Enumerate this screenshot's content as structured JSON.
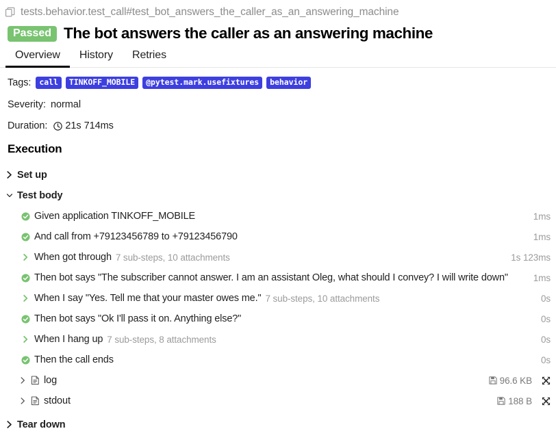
{
  "header": {
    "copy_icon": "copy-icon",
    "full_name": "tests.behavior.test_call#test_bot_answers_the_caller_as_an_answering_machine",
    "status": "Passed",
    "status_color": "#79c371",
    "title": "The bot answers the caller as an answering machine"
  },
  "tabs": [
    {
      "label": "Overview",
      "active": true
    },
    {
      "label": "History",
      "active": false
    },
    {
      "label": "Retries",
      "active": false
    }
  ],
  "meta": {
    "tags_label": "Tags:",
    "tag_chip_color": "#3d3fe0",
    "tags": [
      "call",
      "TINKOFF_MOBILE",
      "@pytest.mark.usefixtures",
      "behavior"
    ],
    "severity_label": "Severity:",
    "severity_value": "normal",
    "duration_label": "Duration:",
    "duration_icon": "clock-icon",
    "duration_value": "21s 714ms"
  },
  "execution": {
    "heading": "Execution",
    "setup": {
      "label": "Set up",
      "icon": "chevron-right-icon",
      "expanded": false
    },
    "test_body": {
      "label": "Test body",
      "icon": "chevron-down-icon",
      "expanded": true,
      "steps": [
        {
          "icon": "check-circle-icon",
          "name": "Given application TINKOFF_MOBILE",
          "sub": "",
          "duration": "1ms"
        },
        {
          "icon": "check-circle-icon",
          "name": "And call from +79123456789 to +79123456790",
          "sub": "",
          "duration": "1ms"
        },
        {
          "icon": "chevron-right-icon",
          "name": "When got through",
          "sub": "7 sub-steps, 10 attachments",
          "duration": "1s 123ms"
        },
        {
          "icon": "check-circle-icon",
          "name": "Then bot says \"The subscriber cannot answer. I am an assistant Oleg, what should I convey? I will write down\"",
          "sub": "",
          "duration": "1ms"
        },
        {
          "icon": "chevron-right-icon",
          "name": "When I say \"Yes. Tell me that your master owes me.\"",
          "sub": "7 sub-steps, 10 attachments",
          "duration": "0s"
        },
        {
          "icon": "check-circle-icon",
          "name": "Then bot says \"Ok I'll pass it on. Anything else?\"",
          "sub": "",
          "duration": "0s"
        },
        {
          "icon": "chevron-right-icon",
          "name": "When I hang up",
          "sub": "7 sub-steps, 8 attachments",
          "duration": "0s"
        },
        {
          "icon": "check-circle-icon",
          "name": "Then the call ends",
          "sub": "",
          "duration": "0s"
        }
      ],
      "attachments": [
        {
          "chevron_icon": "chevron-right-icon",
          "file_icon": "document-icon",
          "name": "log",
          "save_icon": "save-icon",
          "size": "96.6 KB",
          "expand_icon": "expand-icon"
        },
        {
          "chevron_icon": "chevron-right-icon",
          "file_icon": "document-icon",
          "name": "stdout",
          "save_icon": "save-icon",
          "size": "188 B",
          "expand_icon": "expand-icon"
        }
      ]
    },
    "teardown": {
      "label": "Tear down",
      "icon": "chevron-right-icon",
      "expanded": false
    }
  }
}
